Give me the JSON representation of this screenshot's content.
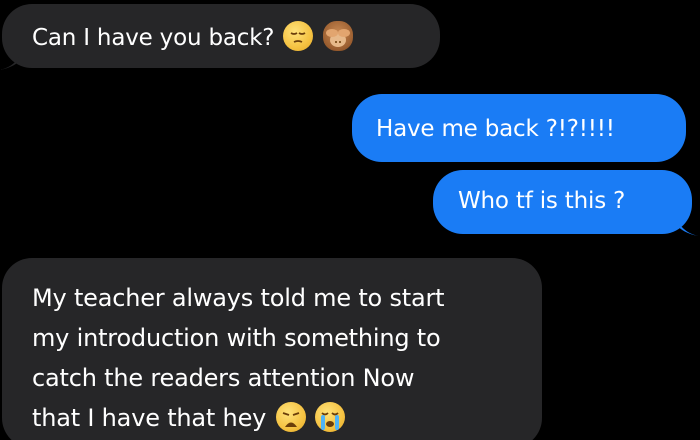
{
  "conversation": {
    "messages": [
      {
        "direction": "incoming",
        "text": "Can I have you back?",
        "emojis": [
          "pensive-face-icon",
          "see-no-evil-monkey-icon"
        ]
      },
      {
        "direction": "outgoing",
        "text": "Have me back ?!?!!!!"
      },
      {
        "direction": "outgoing",
        "text": "Who tf is this ?"
      },
      {
        "direction": "incoming",
        "lines": [
          "My teacher always told me to start",
          "my introduction with something to",
          "catch the readers attention Now",
          "that I have that hey"
        ],
        "emojis": [
          "weary-face-icon",
          "loudly-crying-face-icon"
        ]
      }
    ]
  },
  "colors": {
    "background": "#000000",
    "incoming_bubble": "#262628",
    "outgoing_bubble": "#1a7cf5",
    "text": "#ffffff"
  }
}
